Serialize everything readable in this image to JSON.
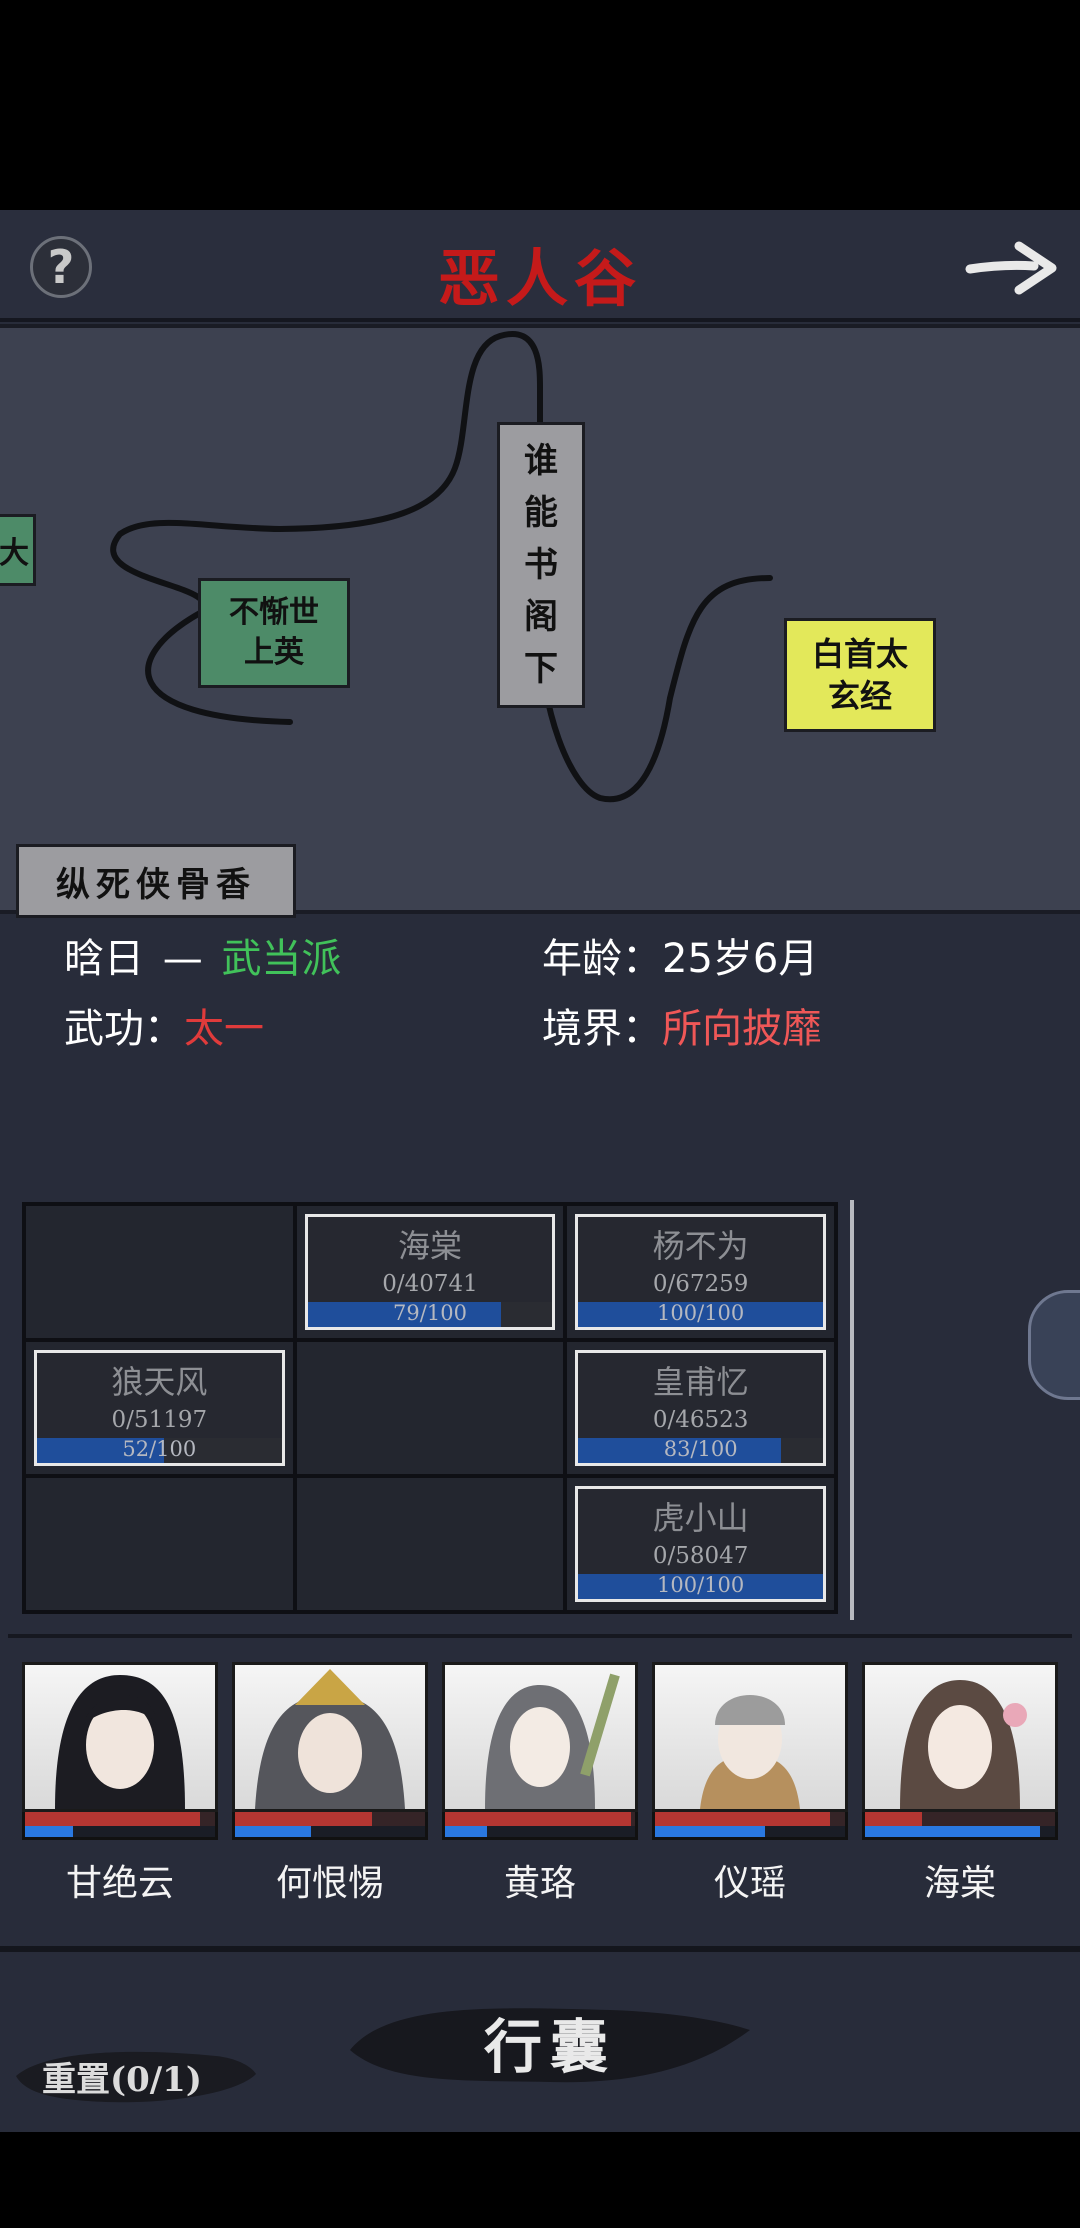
{
  "header": {
    "help_icon": "?",
    "title": "恶人谷",
    "next_icon": "arrow-right-icon"
  },
  "map": {
    "nodes": [
      {
        "label": "大",
        "color": "#4d8b68"
      },
      {
        "label": "不惭世上英",
        "color": "#4d8b68"
      },
      {
        "label": "谁能书阁下",
        "color": "#9c9ca0"
      },
      {
        "label": "白首太玄经",
        "color": "#e3e85a"
      },
      {
        "label": "纵死侠骨香",
        "color": "#9c9ca0"
      }
    ]
  },
  "info": {
    "name": "晗日",
    "dash": "—",
    "sect": "武当派",
    "age_label": "年龄：",
    "age": "25岁6月",
    "skill_label": "武功：",
    "skill": "太一",
    "realm_label": "境界：",
    "realm": "所向披靡",
    "colors": {
      "sect": "#41c25a",
      "skill": "#e03b3b",
      "realm": "#ef5757"
    }
  },
  "grid": {
    "cards": [
      {
        "name": "海棠",
        "exp": "0/40741",
        "bar_text": "79/100",
        "fill": 0.79
      },
      {
        "name": "杨不为",
        "exp": "0/67259",
        "bar_text": "100/100",
        "fill": 1.0
      },
      {
        "name": "狼天风",
        "exp": "0/51197",
        "bar_text": "52/100",
        "fill": 0.52
      },
      {
        "name": "皇甫忆",
        "exp": "0/46523",
        "bar_text": "83/100",
        "fill": 0.83
      },
      {
        "name": "虎小山",
        "exp": "0/58047",
        "bar_text": "100/100",
        "fill": 1.0
      }
    ]
  },
  "party": [
    {
      "name": "甘绝云",
      "hp": 0.92,
      "mp": 0.25
    },
    {
      "name": "何恨惕",
      "hp": 0.72,
      "mp": 0.4
    },
    {
      "name": "黄珞",
      "hp": 0.98,
      "mp": 0.22
    },
    {
      "name": "仪瑶",
      "hp": 0.92,
      "mp": 0.58
    },
    {
      "name": "海棠",
      "hp": 0.3,
      "mp": 0.92
    }
  ],
  "footer": {
    "bag": "行囊",
    "reset": "重置(0/1)"
  }
}
